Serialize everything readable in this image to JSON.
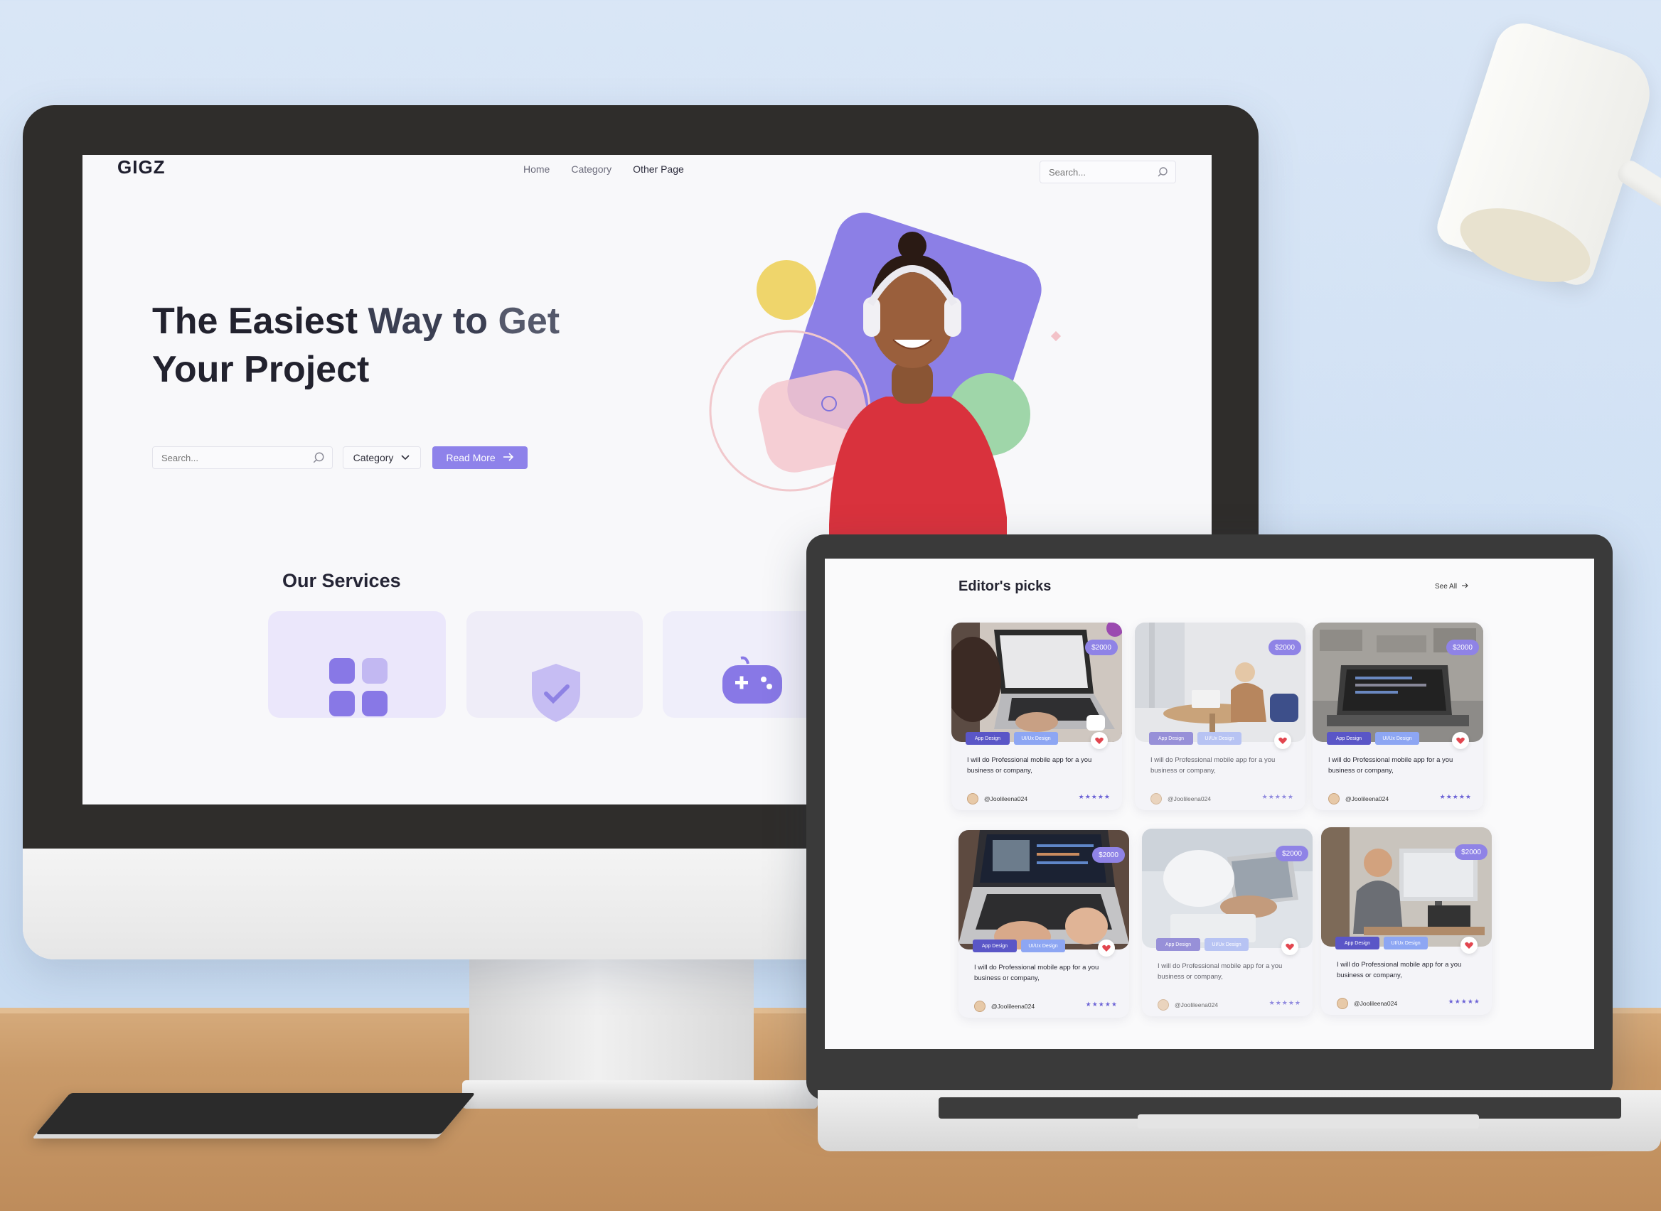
{
  "monitor_site": {
    "logo": "GIGZ",
    "nav": [
      "Home",
      "Category",
      "Other Page"
    ],
    "top_search": {
      "placeholder": "Search..."
    },
    "hero": {
      "line1_a": "The Easiest ",
      "line1_b": "Way to ",
      "line1_c": "Get",
      "line2": "Your Project"
    },
    "hero_search": {
      "placeholder": "Search..."
    },
    "category_select": {
      "value": "Category"
    },
    "read_more": "Read More",
    "services_title": "Our Services",
    "accent": "#8e82ea"
  },
  "laptop_site": {
    "title": "Editor's picks",
    "see_all": "See All",
    "cards": [
      {
        "price": "$2000",
        "tags": [
          "App Design",
          "UI/Ux Design"
        ],
        "desc": "I will do Professional mobile app for a you business or company,",
        "user": "@Joolileena024",
        "stars": "★★★★★"
      },
      {
        "price": "$2000",
        "tags": [
          "App Design",
          "UI/Ux Design"
        ],
        "desc": "I will do Professional mobile app for a you business or company,",
        "user": "@Joolileena024",
        "stars": "★★★★★"
      },
      {
        "price": "$2000",
        "tags": [
          "App Design",
          "UI/Ux Design"
        ],
        "desc": "I will do Professional mobile app for a you business or company,",
        "user": "@Joolileena024",
        "stars": "★★★★★"
      },
      {
        "price": "$2000",
        "tags": [
          "App Design",
          "UI/Ux Design"
        ],
        "desc": "I will do Professional mobile app for a you business or company,",
        "user": "@Joolileena024",
        "stars": "★★★★★"
      },
      {
        "price": "$2000",
        "tags": [
          "App Design",
          "UI/Ux Design"
        ],
        "desc": "I will do Professional mobile app for a you business or company,",
        "user": "@Joolileena024",
        "stars": "★★★★★"
      },
      {
        "price": "$2000",
        "tags": [
          "App Design",
          "UI/Ux Design"
        ],
        "desc": "I will do Professional mobile app for a you business or company,",
        "user": "@Joolileena024",
        "stars": "★★★★★"
      }
    ]
  }
}
